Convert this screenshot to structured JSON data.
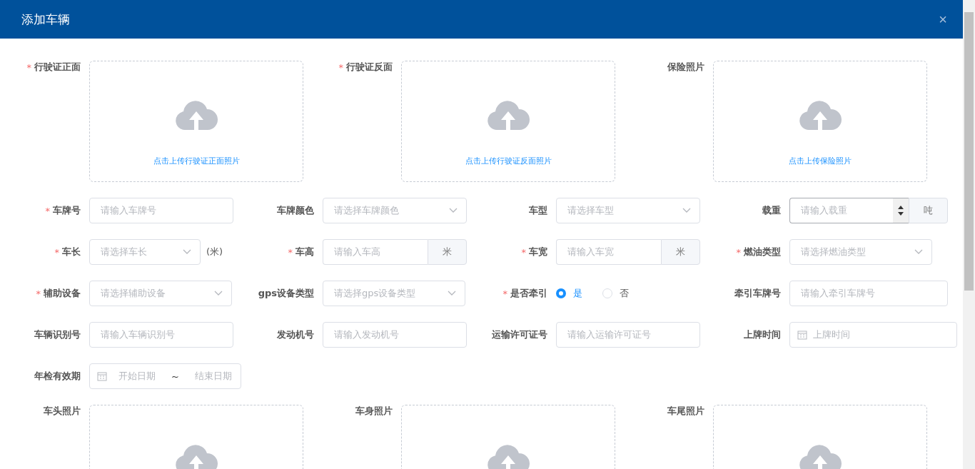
{
  "dialog": {
    "title": "添加车辆",
    "close": "×"
  },
  "uploads_top": [
    {
      "label": "行驶证正面",
      "mark": "*",
      "hint": "点击上传行驶证正面照片"
    },
    {
      "label": "行驶证反面",
      "mark": "*",
      "hint": "点击上传行驶证反面照片"
    },
    {
      "label": "保险照片",
      "hint": "点击上传保险照片"
    }
  ],
  "rows": [
    [
      {
        "kind": "text",
        "label": "车牌号",
        "mark": "*",
        "placeholder": "请输入车牌号"
      },
      {
        "kind": "select",
        "label": "车牌颜色",
        "placeholder": "请选择车牌颜色"
      },
      {
        "kind": "select",
        "label": "车型",
        "placeholder": "请选择车型"
      },
      {
        "kind": "number",
        "label": "载重",
        "placeholder": "请输入载重",
        "unit": "吨"
      }
    ],
    [
      {
        "kind": "select-note",
        "label": "车长",
        "mark": "*",
        "placeholder": "请选择车长",
        "note": "(米)"
      },
      {
        "kind": "unit",
        "label": "车高",
        "mark": "*",
        "placeholder": "请输入车高",
        "unit": "米"
      },
      {
        "kind": "unit",
        "label": "车宽",
        "mark": "*",
        "placeholder": "请输入车宽",
        "unit": "米"
      },
      {
        "kind": "select",
        "label": "燃油类型",
        "mark": "*",
        "placeholder": "请选择燃油类型"
      }
    ],
    [
      {
        "kind": "select",
        "label": "辅助设备",
        "mark": "*",
        "placeholder": "请选择辅助设备"
      },
      {
        "kind": "select",
        "label": "gps设备类型",
        "placeholder": "请选择gps设备类型"
      },
      {
        "kind": "radio",
        "label": "是否牵引",
        "mark": "*",
        "options": [
          {
            "label": "是",
            "selected": true
          },
          {
            "label": "否",
            "selected": false
          }
        ]
      },
      {
        "kind": "text",
        "label": "牵引车牌号",
        "placeholder": "请输入牵引车牌号"
      }
    ],
    [
      {
        "kind": "text",
        "label": "车辆识别号",
        "placeholder": "请输入车辆识别号"
      },
      {
        "kind": "text",
        "label": "发动机号",
        "placeholder": "请输入发动机号"
      },
      {
        "kind": "text",
        "label": "运输许可证号",
        "placeholder": "请输入运输许可证号"
      },
      {
        "kind": "date",
        "label": "上牌时间",
        "placeholder": "上牌时间"
      }
    ],
    [
      {
        "kind": "daterange",
        "label": "年检有效期",
        "start": "开始日期",
        "separator": "~",
        "end": "结束日期"
      }
    ]
  ],
  "uploads_bottom": [
    {
      "label": "车头照片"
    },
    {
      "label": "车身照片"
    },
    {
      "label": "车尾照片"
    }
  ]
}
